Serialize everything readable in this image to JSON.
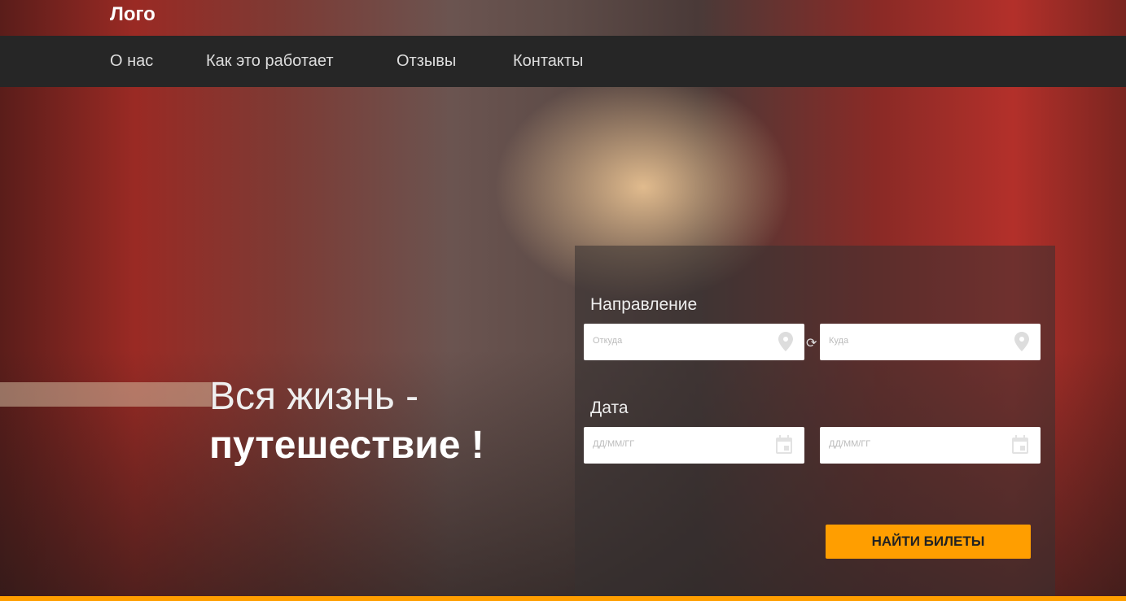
{
  "logo": "Лого",
  "nav": [
    "О нас",
    "Как это работает",
    "Отзывы",
    "Контакты"
  ],
  "hero": {
    "line1": "Вся жизнь -",
    "line2": "путешествие !"
  },
  "form": {
    "direction_label": "Направление",
    "from_placeholder": "Откуда",
    "to_placeholder": "Куда",
    "date_label": "Дата",
    "date_placeholder_1": "ДД/ММ/ГГ",
    "date_placeholder_2": "ДД/ММ/ГГ",
    "submit": "НАЙТИ БИЛЕТЫ"
  },
  "colors": {
    "accent": "#ff9e00",
    "nav_bg": "#262626"
  }
}
